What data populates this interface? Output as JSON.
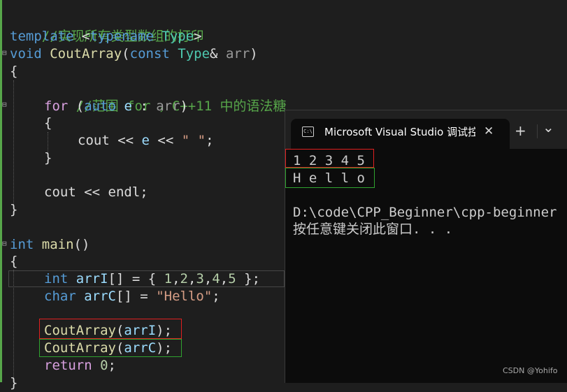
{
  "code": {
    "line1_comment": "//实现所有类型数组的打印",
    "line2": {
      "kw": "template",
      "open": " <",
      "kw2": "typename",
      "sp": " ",
      "ty": "Type",
      "close": ">"
    },
    "line3": {
      "kw": "void",
      "sp": " ",
      "fn": "CoutArray",
      "open": "(",
      "kw2": "const",
      "sp2": " ",
      "ty": "Type",
      "amp": "& ",
      "param": "arr",
      "close": ")"
    },
    "line4": "{",
    "line5_comment": "//范围 for ，C++11 中的语法糖",
    "line6": {
      "kw": "for",
      "open": " (",
      "kw2": "auto",
      "sp": " ",
      "var": "e",
      "colon": " : ",
      "param": "arr",
      "close": ")"
    },
    "line7": "{",
    "line8": {
      "pre": "cout << ",
      "var": "e",
      "mid": " << ",
      "str": "\" \"",
      "end": ";"
    },
    "line9": "}",
    "line10": "cout << endl;",
    "line11": "}",
    "line12": {
      "kw": "int",
      "sp": " ",
      "fn": "main",
      "rest": "()"
    },
    "line13": "{",
    "line14": {
      "kw": "int",
      "sp": " ",
      "var": "arrI",
      "eq": "[] = { ",
      "n1": "1",
      "c1": ",",
      "n2": "2",
      "c2": ",",
      "n3": "3",
      "c3": ",",
      "n4": "4",
      "c4": ",",
      "n5": "5",
      "end": " };"
    },
    "line15": {
      "kw": "char",
      "sp": " ",
      "var": "arrC",
      "eq": "[] = ",
      "str": "\"Hello\"",
      "end": ";"
    },
    "line16": {
      "fn": "CoutArray",
      "open": "(",
      "var": "arrI",
      "end": ");"
    },
    "line17": {
      "fn": "CoutArray",
      "open": "(",
      "var": "arrC",
      "end": ");"
    },
    "line18": {
      "kw": "return",
      "sp": " ",
      "num": "0",
      "end": ";"
    }
  },
  "console": {
    "tab_icon": "C:\\",
    "tab_title": "Microsoft Visual Studio 调试控制台",
    "close_glyph": "✕",
    "new_tab_glyph": "+",
    "dropdown_glyph": "⌄",
    "output_line1": "1 2 3 4 5",
    "output_line2": "H e l l o",
    "path_line": "D:\\code\\CPP_Beginner\\cpp-beginner",
    "prompt_line": "按任意键关闭此窗口. . ."
  },
  "watermark": "CSDN @Yohifo",
  "colors": {
    "highlight_red": "#e02020",
    "highlight_green": "#2fa32f",
    "comment": "#57a64a",
    "keyword": "#569cd6",
    "type": "#4ec9b0",
    "function": "#dcdcaa",
    "string": "#d69d85"
  },
  "icons": [
    "fold-minus-icon",
    "console-app-icon",
    "close-icon",
    "new-tab-icon",
    "chevron-down-icon"
  ]
}
